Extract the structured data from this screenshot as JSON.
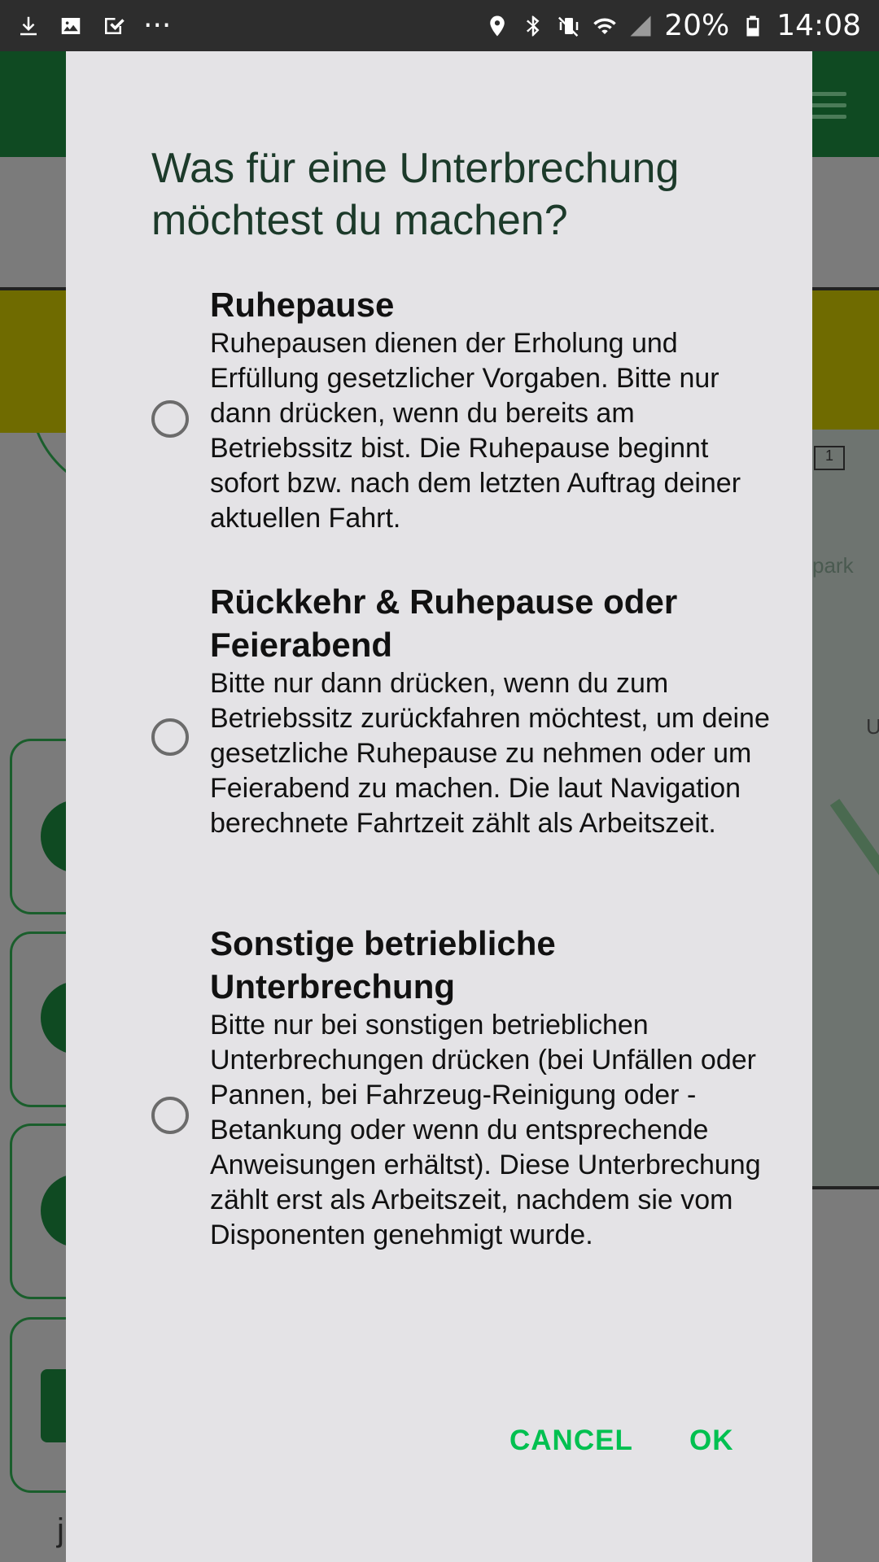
{
  "status_bar": {
    "left_icons": [
      "download-icon",
      "image-icon",
      "check-icon"
    ],
    "more": "···",
    "battery_percent": "20%",
    "time": "14:08"
  },
  "background": {
    "map_badge": "1",
    "map_text": "park",
    "map_letter": "U",
    "partial_letter": "j"
  },
  "dialog": {
    "title": "Was für eine Unterbrechung möchtest du machen?",
    "options": [
      {
        "title": "Ruhepause",
        "description": "Ruhepausen dienen der Erholung und Erfüllung gesetzlicher Vorgaben. Bitte nur dann drücken, wenn du bereits am Betriebssitz bist. Die Ruhepause beginnt sofort bzw. nach dem letzten Auftrag deiner aktuellen Fahrt.",
        "selected": false
      },
      {
        "title": "Rückkehr & Ruhepause oder Feierabend",
        "description": "Bitte nur dann drücken, wenn du zum Betriebssitz zurückfahren möchtest, um deine gesetzliche Ruhepause zu nehmen oder um Feierabend zu machen. Die laut Navigation berechnete Fahrtzeit zählt als Arbeitszeit.",
        "selected": false
      },
      {
        "title": "Sonstige betriebliche Unterbrechung",
        "description": "Bitte nur bei sonstigen betrieblichen Unterbrechungen drücken (bei Unfällen oder Pannen, bei Fahrzeug-Reinigung oder -Betankung oder wenn du entsprechende Anweisungen erhältst). Diese Unterbrechung zählt erst als Arbeitszeit, nachdem sie vom Disponenten genehmigt wurde.",
        "selected": false
      }
    ],
    "cancel_label": "CANCEL",
    "ok_label": "OK"
  },
  "colors": {
    "accent": "#00c050",
    "dialog_bg": "#e4e3e6",
    "title_text": "#1c3a2a",
    "status_bar": "#2d2d2d",
    "brand_green": "#0f4a22"
  }
}
